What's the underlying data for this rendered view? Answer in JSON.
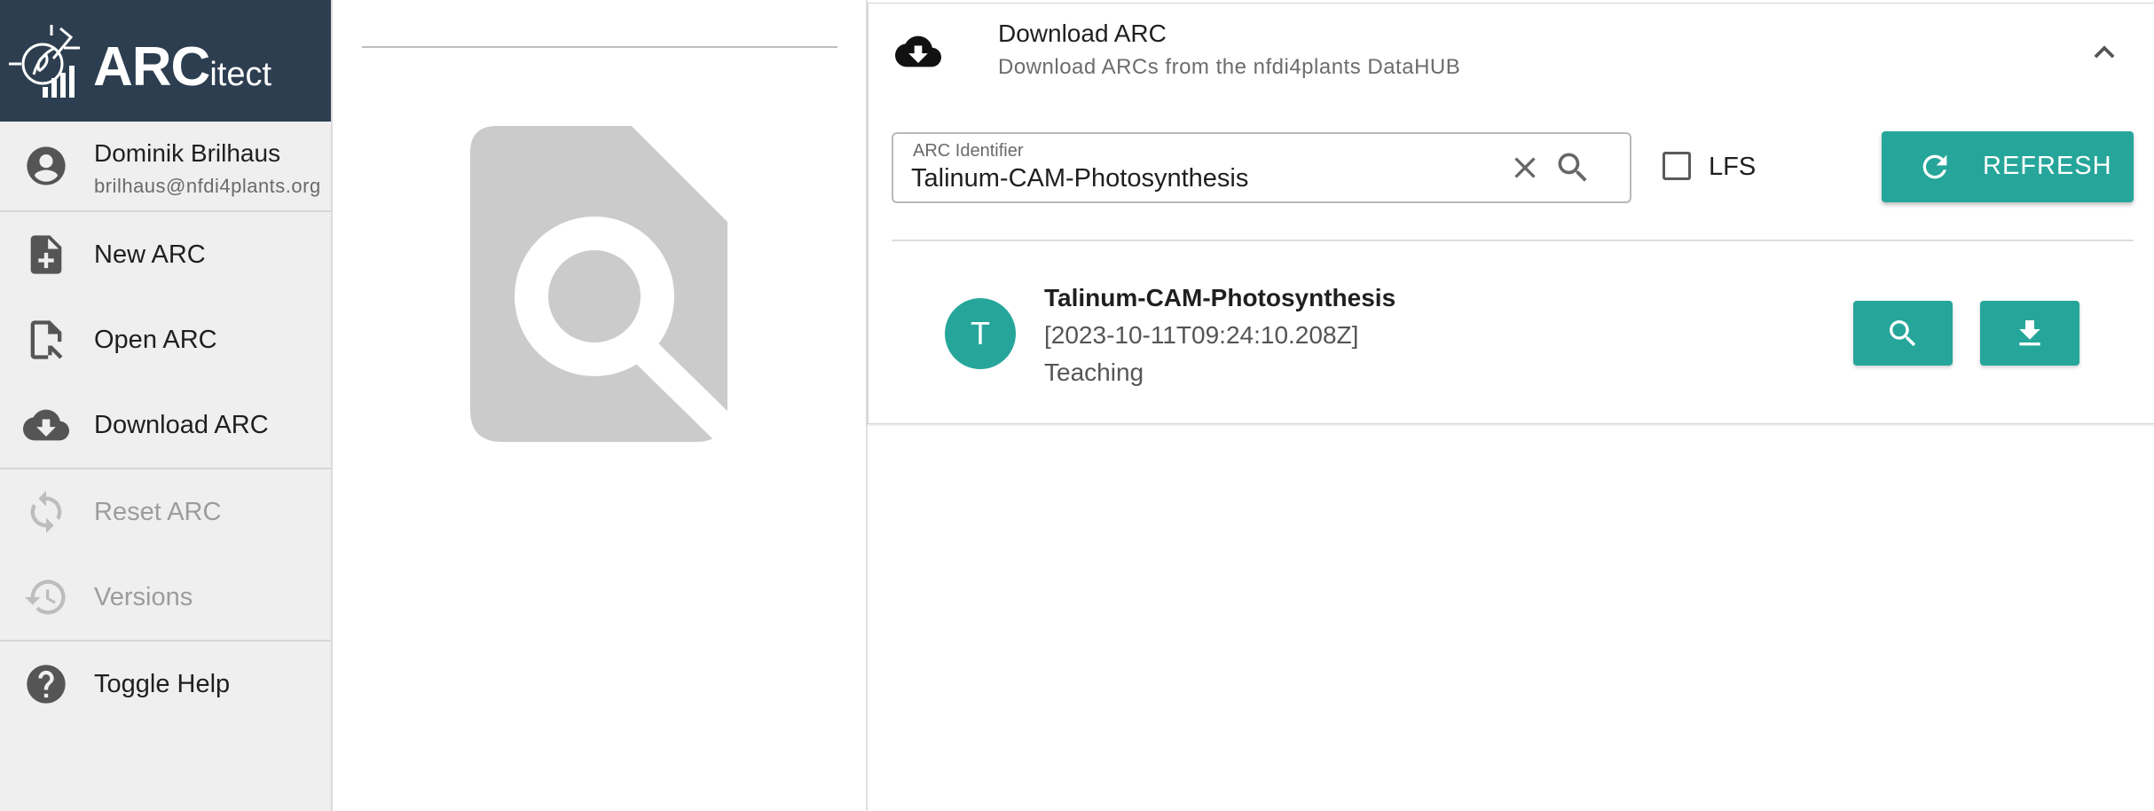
{
  "app": {
    "logo_main": "ARC",
    "logo_suffix": "itect"
  },
  "user": {
    "name": "Dominik Brilhaus",
    "email": "brilhaus@nfdi4plants.org"
  },
  "sidebar": {
    "items": [
      {
        "label": "New ARC",
        "icon": "file-plus-icon",
        "enabled": true
      },
      {
        "label": "Open ARC",
        "icon": "file-open-icon",
        "enabled": true
      },
      {
        "label": "Download ARC",
        "icon": "cloud-download-icon",
        "enabled": true
      },
      {
        "label": "Reset ARC",
        "icon": "sync-icon",
        "enabled": false
      },
      {
        "label": "Versions",
        "icon": "history-icon",
        "enabled": false
      },
      {
        "label": "Toggle Help",
        "icon": "help-icon",
        "enabled": true
      }
    ]
  },
  "download_panel": {
    "title": "Download ARC",
    "subtitle": "Download ARCs from the nfdi4plants DataHUB",
    "search": {
      "label": "ARC Identifier",
      "value": "Talinum-CAM-Photosynthesis"
    },
    "lfs_label": "LFS",
    "lfs_checked": false,
    "refresh_label": "REFRESH",
    "results": [
      {
        "avatar": "T",
        "name": "Talinum-CAM-Photosynthesis",
        "date": "[2023-10-11T09:24:10.208Z]",
        "group": "Teaching"
      }
    ]
  },
  "colors": {
    "accent": "#26a69a",
    "header_bg": "#2d3e50",
    "sidebar_bg": "#efefef"
  }
}
